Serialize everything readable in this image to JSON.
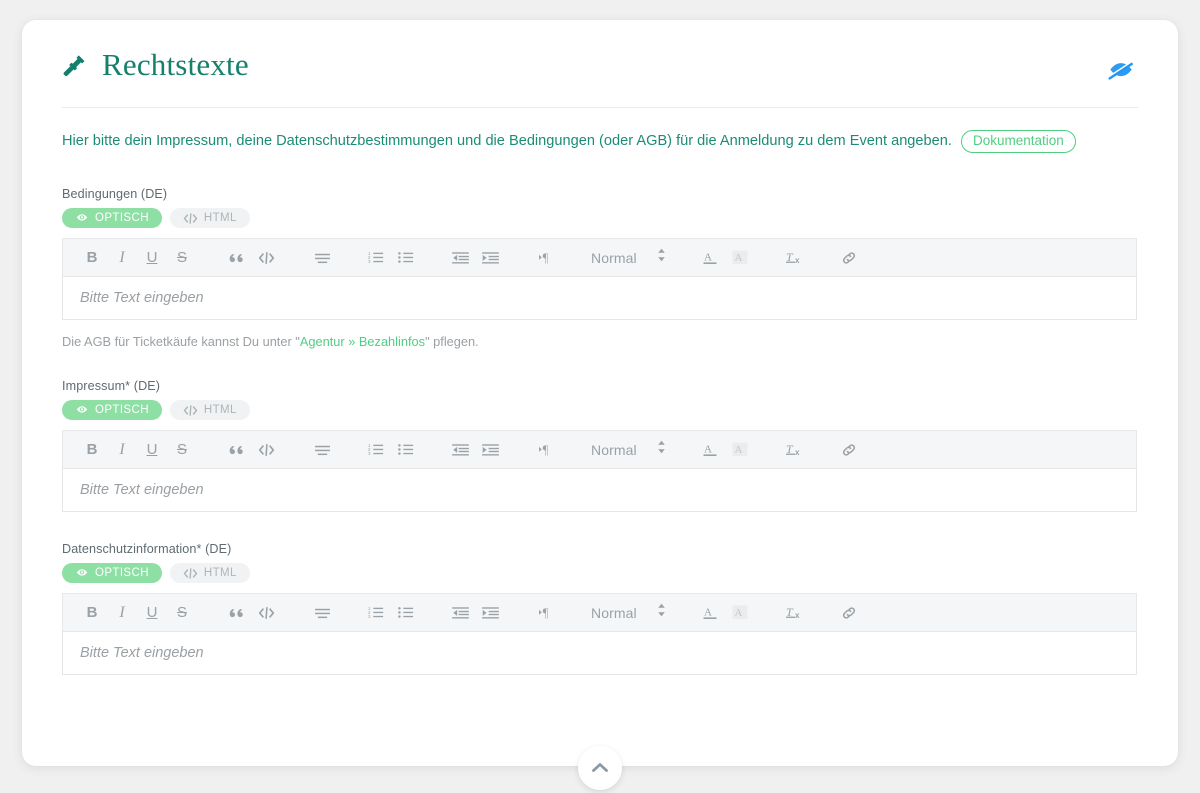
{
  "page": {
    "title": "Rechtstexte",
    "title_icon": "gavel-icon",
    "hide_icon": "eye-slash-icon",
    "description": "Hier bitte dein Impressum, deine Datenschutzbestimmungen und die Bedingungen (oder AGB) für die Anmeldung zu dem Event angeben.",
    "doc_badge": "Dokumentation",
    "scroll_top_icon": "chevron-up-icon"
  },
  "colors": {
    "title": "#15806c",
    "accent_green": "#4fcf82",
    "pill_active_bg": "#8ddfa3",
    "hide_icon": "#2196f3",
    "description_text": "#1b8c76",
    "toolbar_bg": "#f4f6f7",
    "muted": "#9aa0a4"
  },
  "mode_tabs": {
    "visual_label": "OPTISCH",
    "html_label": "HTML",
    "visual_icon": "eye-icon",
    "html_icon": "code-icon"
  },
  "toolbar": {
    "bold": "B",
    "italic": "I",
    "underline": "U",
    "strike": "S",
    "blockquote": "”",
    "code": "</>",
    "align": "align-left-icon",
    "ordered_list": "ordered-list-icon",
    "bullet_list": "bullet-list-icon",
    "outdent": "outdent-icon",
    "indent": "indent-icon",
    "direction": "text-direction-icon",
    "format_value": "Normal",
    "format_caret": "chevron-updown-icon",
    "text_color": "text-color-icon",
    "background_color": "background-color-icon",
    "clear_format": "clear-format-icon",
    "link": "link-icon"
  },
  "editor": {
    "placeholder": "Bitte Text eingeben"
  },
  "fields": [
    {
      "label": "Bedingungen (DE)",
      "hint_before": "Die AGB für Ticketkäufe kannst Du unter \"",
      "hint_link": "Agentur » Bezahlinfos",
      "hint_after": "\" pflegen."
    },
    {
      "label": "Impressum* (DE)"
    },
    {
      "label": "Datenschutzinformation* (DE)"
    }
  ]
}
